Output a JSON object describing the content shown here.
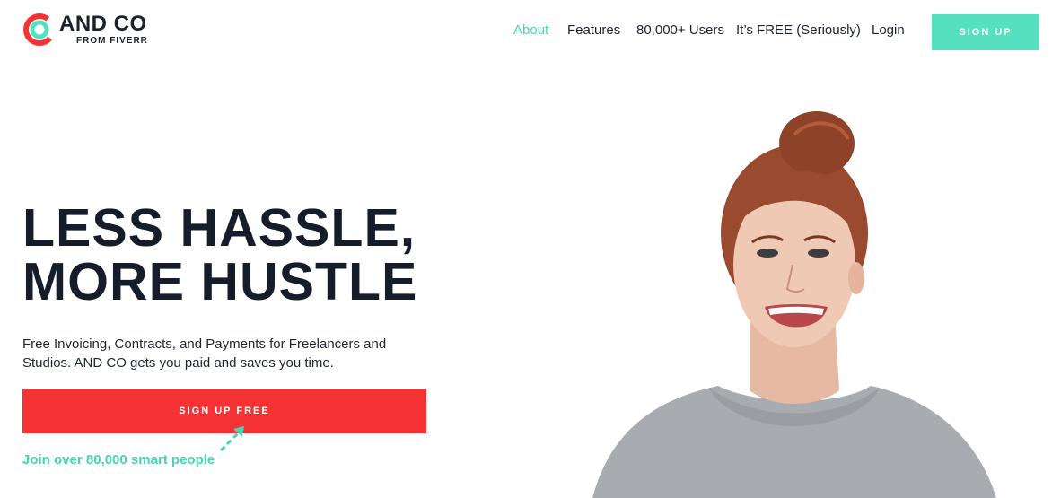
{
  "brand": {
    "name": "AND CO",
    "sub": "FROM FIVERR",
    "colors": {
      "red": "#f53334",
      "teal": "#55e0c0"
    }
  },
  "nav": {
    "items": [
      {
        "label": "About",
        "active": true
      },
      {
        "label": "Features",
        "active": false
      },
      {
        "label": "80,000+ Users",
        "active": false
      },
      {
        "label": "It’s FREE (Seriously)",
        "active": false
      },
      {
        "label": "Login",
        "active": false
      }
    ],
    "signup_label": "SIGN UP"
  },
  "hero": {
    "title_line1": "LESS HASSLE,",
    "title_line2": "MORE HUSTLE",
    "subtitle": "Free Invoicing, Contracts, and Payments for Freelancers and Studios. AND CO gets you paid and saves you time.",
    "cta_label": "SIGN UP FREE",
    "join_text": "Join over 80,000 smart people"
  },
  "image": {
    "alt": "smiling-woman-photo"
  }
}
